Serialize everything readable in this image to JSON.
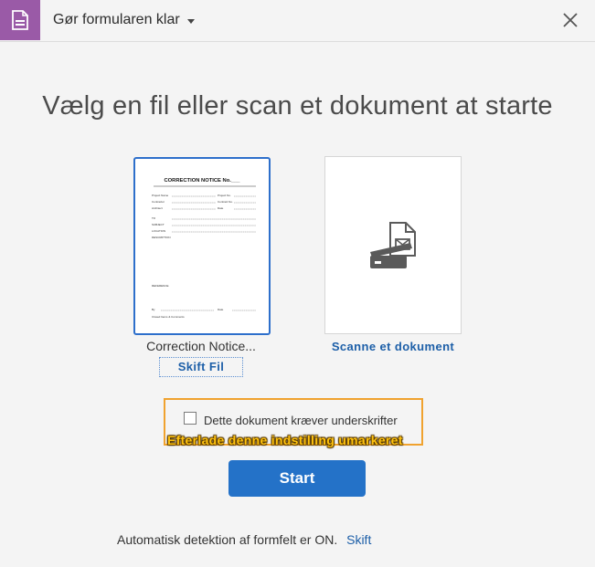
{
  "titlebar": {
    "title": "Gør formularen klar",
    "app_icon": "pdf-form-icon",
    "close_icon": "close-icon",
    "accent_color": "#9a5aa7"
  },
  "main": {
    "heading": "Vælg en fil eller scan et dokument at starte",
    "file_card": {
      "file_name": "Correction Notice...",
      "change_label": "Skift Fil",
      "thumbnail": {
        "doc_title": "CORRECTION NOTICE No.___",
        "fields_left": [
          "Project Name",
          "Contractor",
          "Architect"
        ],
        "fields_right": [
          "Project No.",
          "Contract No.",
          "Date"
        ],
        "sections": [
          "TO",
          "SUBJECT",
          "LOCATION",
          "DESCRIPTION"
        ],
        "reference": "REFERENCE",
        "by_label": "By",
        "date_label": "Date",
        "footer_note": "Closed Items & Comments"
      }
    },
    "scan_card": {
      "label": "Scanne et dokument",
      "icon": "scanner-icon"
    },
    "signature": {
      "label": "Dette dokument kræver underskrifter",
      "checked": false,
      "hint": "Efterlade denne indstilling umarkeret",
      "highlight_color": "#f0a22e"
    },
    "start_button": "Start",
    "accent_blue": "#2472c8"
  },
  "footer": {
    "text": "Automatisk detektion af formfelt er ON.",
    "link": "Skift"
  }
}
